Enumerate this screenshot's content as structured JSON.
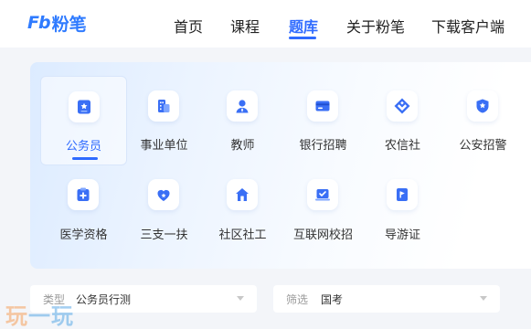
{
  "header": {
    "logo_mark": "Fb",
    "logo_text": "粉笔",
    "nav": [
      {
        "label": "首页",
        "active": false
      },
      {
        "label": "课程",
        "active": false
      },
      {
        "label": "题库",
        "active": true
      },
      {
        "label": "关于粉笔",
        "active": false
      },
      {
        "label": "下载客户端",
        "active": false
      }
    ]
  },
  "categories": [
    {
      "label": "公务员",
      "icon": "star-card-icon",
      "selected": true
    },
    {
      "label": "事业单位",
      "icon": "building-icon",
      "selected": false
    },
    {
      "label": "教师",
      "icon": "teacher-icon",
      "selected": false
    },
    {
      "label": "银行招聘",
      "icon": "bank-card-icon",
      "selected": false
    },
    {
      "label": "农信社",
      "icon": "cooperative-logo-icon",
      "selected": false
    },
    {
      "label": "公安招警",
      "icon": "police-badge-icon",
      "selected": false
    },
    {
      "label": "医学资格",
      "icon": "medical-kit-icon",
      "selected": false
    },
    {
      "label": "三支一扶",
      "icon": "heart-star-icon",
      "selected": false
    },
    {
      "label": "社区社工",
      "icon": "community-house-icon",
      "selected": false
    },
    {
      "label": "互联网校招",
      "icon": "laptop-check-icon",
      "selected": false
    },
    {
      "label": "导游证",
      "icon": "flag-icon",
      "selected": false
    }
  ],
  "filters": {
    "type": {
      "label": "类型",
      "value": "公务员行测"
    },
    "screen": {
      "label": "筛选",
      "value": "国考"
    }
  },
  "watermark": {
    "text_a": "玩",
    "text_b": "一玩"
  },
  "colors": {
    "accent": "#2f6bff",
    "icon_blue": "#3a6ff5"
  }
}
